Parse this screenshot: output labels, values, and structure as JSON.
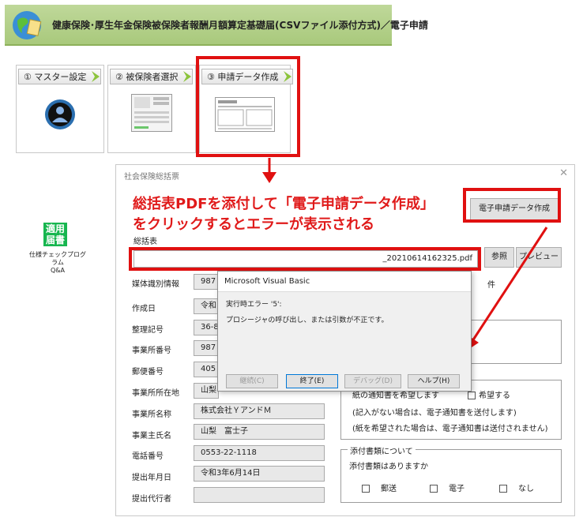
{
  "header": {
    "title": "健康保険･厚生年金保険被保険者報酬月額算定基礎届(CSVファイル添付方式)／電子申請",
    "globe_icon": "globe-icon"
  },
  "steps": [
    {
      "label": "① マスター設定",
      "icon": "user-avatar-icon"
    },
    {
      "label": "② 被保険者選択",
      "icon": "form-thumbnail-icon"
    },
    {
      "label": "③ 申請データ作成",
      "icon": "document-thumbnail-icon"
    }
  ],
  "side": {
    "badge_text": "適用届書",
    "caption_line1": "仕様チェックプログラム",
    "caption_line2": "Q&A"
  },
  "dialog": {
    "title": "社会保険総括票",
    "create_button": "電子申請データ作成",
    "summary_label": "総括表",
    "file_value": "_20210614162325.pdf",
    "browse_button": "参照",
    "preview_button": "プレビュー",
    "count_suffix": "件",
    "labels": {
      "media_id": "媒体識別情報",
      "created_date": "作成日",
      "ref_number": "整理記号",
      "office_number": "事業所番号",
      "postal_code": "郵便番号",
      "office_address": "事業所所在地",
      "office_name": "事業所名称",
      "owner_name": "事業主氏名",
      "phone": "電話番号",
      "submit_date": "提出年月日",
      "agent": "提出代行者"
    },
    "values": {
      "media_id": "987",
      "created_date": "令和",
      "ref_number": "36-8",
      "office_number": "987",
      "postal_code": "405",
      "office_address": "山梨",
      "office_name": "株式会社ＹアンドＭ",
      "owner_name": "山梨　富士子",
      "phone": "0553-22-1118",
      "submit_date": "令和3年6月14日",
      "agent": ""
    },
    "notice": {
      "row1_left": "紙の通知書を希望します",
      "row1_right": "希望する",
      "note1": "(記入がない場合は、電子通知書を送付します)",
      "note2": "(紙を希望された場合は、電子通知書は送付されません)"
    },
    "attachments": {
      "group_title": "添付書類について",
      "prompt": "添付書類はありますか",
      "options": [
        "郵送",
        "電子",
        "なし"
      ]
    }
  },
  "annotation": {
    "line1": "総括表PDFを添付して「電子申請データ作成」",
    "line2": "をクリックするとエラーが表示される"
  },
  "vb_dialog": {
    "title": "Microsoft Visual Basic",
    "error_line": "実行時エラー '5':",
    "message": "プロシージャの呼び出し、または引数が不正です。",
    "buttons": [
      "継続(C)",
      "終了(E)",
      "デバッグ(D)",
      "ヘルプ(H)"
    ]
  },
  "colors": {
    "highlight_red": "#e01010",
    "header_green": "#a9c97c",
    "badge_green": "#17b64f"
  }
}
